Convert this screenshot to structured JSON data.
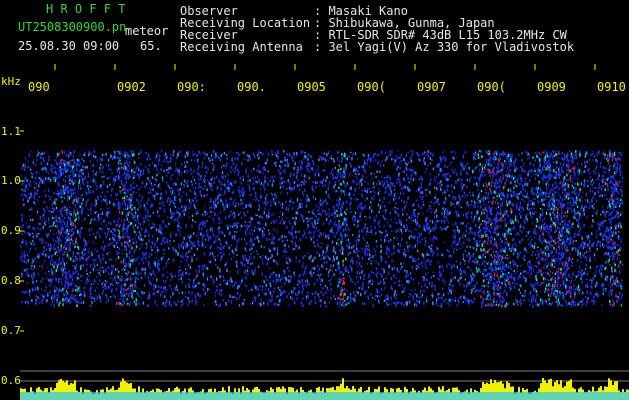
{
  "header": {
    "app_title": "H R O F F T",
    "file_name": "UT2508300900.pn",
    "meteor_label": "meteor",
    "timestamp": "25.08.30 09:00",
    "meteor_count": "65."
  },
  "info": {
    "labels": [
      "Observer",
      "Receiving Location",
      "Receiver",
      "Receiving Antenna"
    ],
    "values": [
      ": Masaki Kano",
      ": Shibukawa, Gunma, Japan",
      ": RTL-SDR SDR# 43dB L15 103.2MHz CW",
      ": 3el Yagi(V) Az 330 for Vladivostok"
    ]
  },
  "spectrogram": {
    "freq_unit": "kHz",
    "freq_ticks": [
      "1.1",
      "1.0",
      "0.9",
      "0.8",
      "0.7",
      "0.6"
    ],
    "time_ticks": [
      "090",
      "0902",
      "090:",
      "090.",
      "0905",
      "090(",
      "0907",
      "090(",
      "0909",
      "0910"
    ],
    "colors": {
      "axis_text": "#f2f200",
      "header_green": "#33d433",
      "signal": "#1e3cff"
    }
  }
}
